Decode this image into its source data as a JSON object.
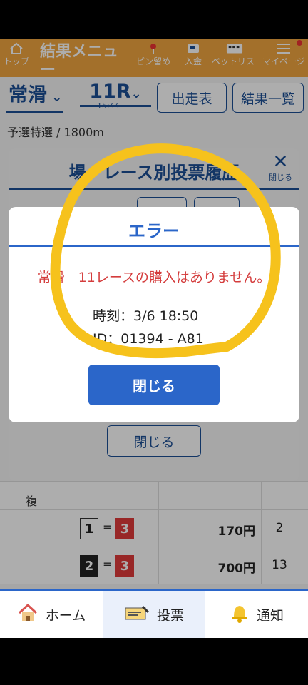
{
  "header": {
    "title": "結果メニュー",
    "items": [
      {
        "label": "トップ",
        "icon": "home-icon"
      },
      {
        "label": "ピン留め",
        "icon": "pin-icon"
      },
      {
        "label": "入金",
        "icon": "card-icon"
      },
      {
        "label": "ベットリスト",
        "icon": "list-icon"
      },
      {
        "label": "マイページ",
        "icon": "menu-icon"
      }
    ]
  },
  "race": {
    "venue": "常滑",
    "race_no": "11R",
    "time": "15:44",
    "btn_entries": "出走表",
    "btn_results": "結果一覧",
    "subtitle": "予選特選 / 1800m"
  },
  "history_modal": {
    "title": "場・レース別投票履歴",
    "close_label": "閉じる",
    "close_button": "閉じる"
  },
  "table": {
    "category": "複",
    "rows": [
      {
        "first": "1",
        "eq": "=",
        "second": "3",
        "price": "170円",
        "popularity": "2"
      },
      {
        "first": "2",
        "eq": "=",
        "second": "3",
        "price": "700円",
        "popularity": "13"
      }
    ]
  },
  "error_dialog": {
    "title": "エラー",
    "message": "常滑　11レースの購入はありません。",
    "time_label": "時刻：3/6 18:50",
    "id_label": "ID：01394 - A81",
    "close_button": "閉じる"
  },
  "bottom_nav": [
    {
      "label": "ホーム",
      "icon": "house-icon",
      "active": false
    },
    {
      "label": "投票",
      "icon": "ticket-icon",
      "active": true
    },
    {
      "label": "通知",
      "icon": "bell-icon",
      "active": false
    }
  ],
  "colors": {
    "header": "#f1a540",
    "brand_blue": "#1b4e95",
    "dialog_blue": "#2b66c9",
    "error_red": "#d43c3c",
    "annotation": "#f6c21c"
  }
}
